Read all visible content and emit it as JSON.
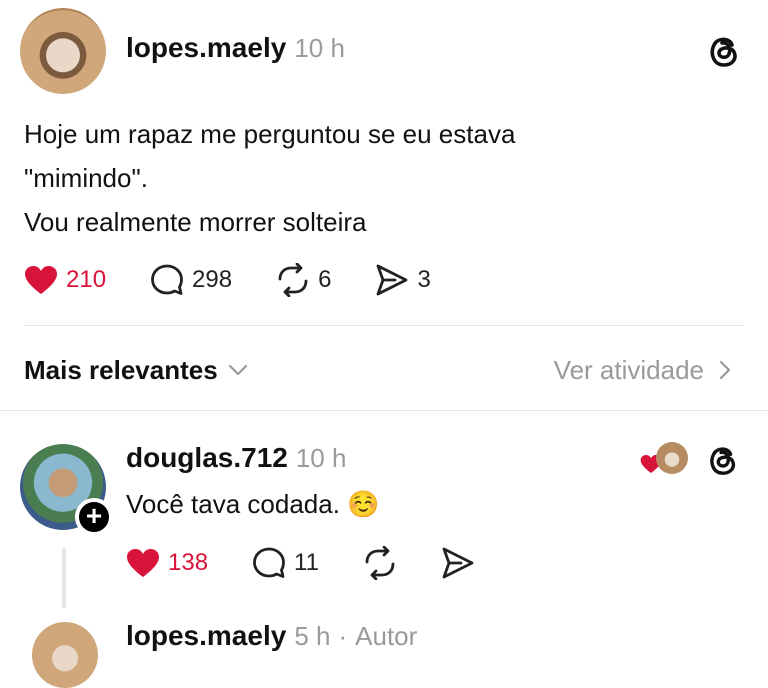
{
  "post": {
    "username": "lopes.maely",
    "time": "10 h",
    "lines": [
      "Hoje um rapaz me perguntou se eu estava",
      "\"mimindo\".",
      "Vou realmente morrer solteira"
    ],
    "likes": "210",
    "comments": "298",
    "reposts": "6",
    "shares": "3"
  },
  "sort": {
    "label": "Mais relevantes",
    "activity_label": "Ver atividade"
  },
  "reply": {
    "username": "douglas.712",
    "time": "10 h",
    "text": "Você tava codada. ☺️",
    "likes": "138",
    "comments": "11"
  },
  "next_reply": {
    "username": "lopes.maely",
    "time": "5 h",
    "tag": "Autor"
  },
  "colors": {
    "like_red": "#d9143a",
    "muted": "#9a9a9a",
    "divider": "#e6e6e6"
  },
  "icons": [
    "threads-icon",
    "heart-icon",
    "comment-icon",
    "repost-icon",
    "share-icon",
    "chevron-down-icon",
    "chevron-right-icon",
    "plus-icon"
  ]
}
